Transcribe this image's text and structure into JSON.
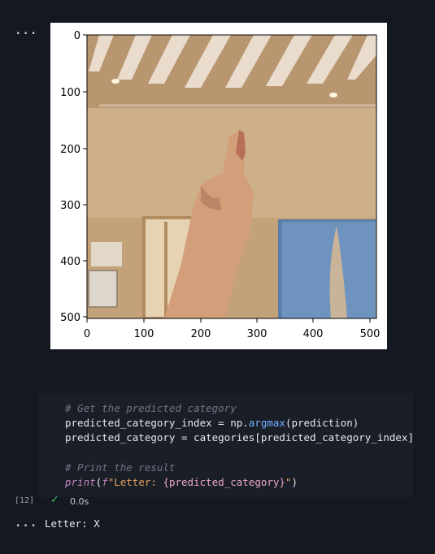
{
  "output_cell": {
    "menu_label": "...",
    "axes": {
      "x_ticks": [
        "0",
        "100",
        "200",
        "300",
        "400",
        "500"
      ],
      "y_ticks": [
        "0",
        "100",
        "200",
        "300",
        "400",
        "500"
      ]
    },
    "image_description": "hand-sign-photo"
  },
  "code_cell": {
    "execution_count": "[12]",
    "status_time": "0.0s",
    "lines": [
      {
        "comment": "# Get the predicted category"
      },
      {
        "lhs": "predicted_category_index",
        "op": " = ",
        "obj": "np.",
        "fn": "argmax",
        "args": "(prediction)"
      },
      {
        "lhs": "predicted_category",
        "op": " = ",
        "rhs": "categories[predicted_category_index]"
      },
      {
        "comment": "# Print the result"
      },
      {
        "fn": "print",
        "open": "(",
        "prefix": "f",
        "str_start": "\"Letter: ",
        "var": "{predicted_category}",
        "str_end": "\"",
        "close": ")"
      }
    ]
  },
  "result": {
    "menu_label": "...",
    "text": "Letter: X"
  },
  "colors": {
    "background": "#141821",
    "cell_background": "#1a1e27",
    "success": "#3fb950"
  }
}
